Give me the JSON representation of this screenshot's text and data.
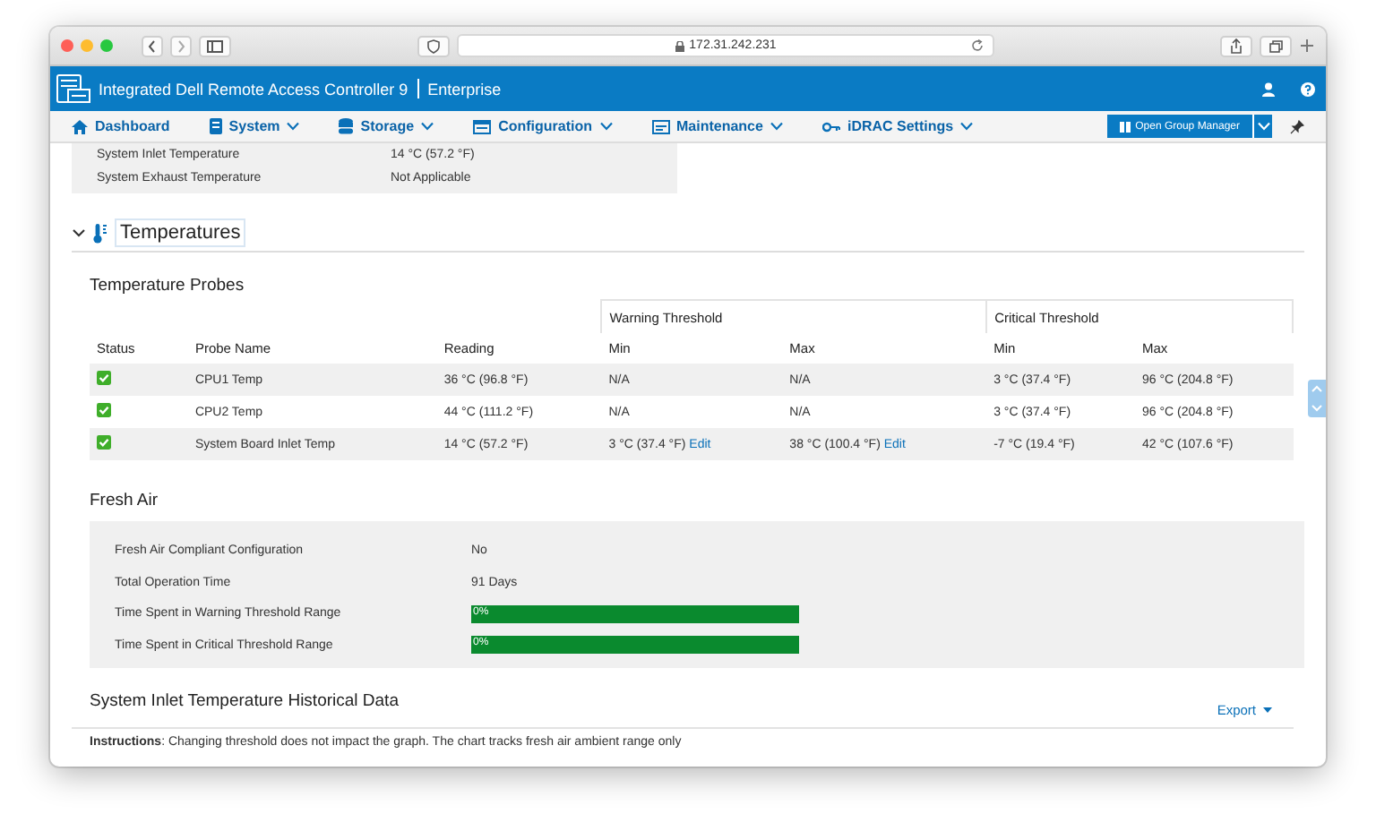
{
  "browser": {
    "address": "172.31.242.231"
  },
  "header": {
    "title": "Integrated Dell Remote Access Controller 9",
    "edition": "Enterprise"
  },
  "nav": {
    "items": [
      {
        "label": "Dashboard",
        "dropdown": false,
        "kind": "home"
      },
      {
        "label": "System",
        "dropdown": true,
        "kind": "server"
      },
      {
        "label": "Storage",
        "dropdown": true,
        "kind": "disk"
      },
      {
        "label": "Configuration",
        "dropdown": true,
        "kind": "config"
      },
      {
        "label": "Maintenance",
        "dropdown": true,
        "kind": "maint"
      },
      {
        "label": "iDRAC Settings",
        "dropdown": true,
        "kind": "key"
      }
    ],
    "group_button": "Open Group Manager"
  },
  "summary": [
    {
      "label": "System Inlet Temperature",
      "value": "14 °C (57.2 °F)"
    },
    {
      "label": "System Exhaust Temperature",
      "value": "Not Applicable"
    }
  ],
  "section": {
    "title": "Temperatures",
    "expanded": true
  },
  "probes": {
    "title": "Temperature Probes",
    "group_headers": [
      "Warning Threshold",
      "Critical Threshold"
    ],
    "columns": [
      "Status",
      "Probe Name",
      "Reading",
      "Min",
      "Max",
      "Min",
      "Max"
    ],
    "rows": [
      {
        "kind": "ok",
        "name": "CPU1 Temp",
        "reading": "36 °C (96.8 °F)",
        "warning_min": {
          "value": "N/A"
        },
        "warning_max": {
          "value": "N/A"
        },
        "critical_min": "3 °C (37.4 °F)",
        "critical_max": "96 °C (204.8 °F)"
      },
      {
        "kind": "ok",
        "name": "CPU2 Temp",
        "reading": "44 °C (111.2 °F)",
        "warning_min": {
          "value": "N/A"
        },
        "warning_max": {
          "value": "N/A"
        },
        "critical_min": "3 °C (37.4 °F)",
        "critical_max": "96 °C (204.8 °F)"
      },
      {
        "kind": "ok",
        "name": "System Board Inlet Temp",
        "reading": "14 °C (57.2 °F)",
        "warning_min": {
          "value": "3 °C (37.4 °F)",
          "link": "Edit"
        },
        "warning_max": {
          "value": "38 °C (100.4 °F)",
          "link": "Edit"
        },
        "critical_min": "-7 °C (19.4 °F)",
        "critical_max": "42 °C (107.6 °F)"
      }
    ]
  },
  "fresh_air": {
    "title": "Fresh Air",
    "rows": [
      {
        "kind": "text",
        "label": "Fresh Air Compliant Configuration",
        "value": "No"
      },
      {
        "kind": "text",
        "label": "Total Operation Time",
        "value": "91 Days"
      },
      {
        "kind": "bar",
        "label": "Time Spent in Warning Threshold Range",
        "level": 1,
        "reading": "0%"
      },
      {
        "kind": "bar",
        "label": "Time Spent in Critical Threshold Range",
        "level": 1,
        "reading": "0%"
      }
    ]
  },
  "history": {
    "title": "System Inlet Temperature Historical Data",
    "export": "Export",
    "instructions": "**Instructions**:  Changing threshold does not impact the graph. The chart tracks fresh air ambient range only"
  }
}
